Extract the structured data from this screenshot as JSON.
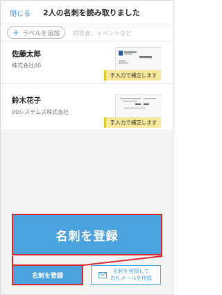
{
  "header": {
    "close_label": "閉じる",
    "title": "2人の名刺を読み取りました"
  },
  "label_bar": {
    "add_label": "ラベルを追加",
    "hint": "同窓会、イベントなど"
  },
  "cards": [
    {
      "name": "佐藤太郎",
      "company": "株式会社00",
      "tag": "手入力で補正します",
      "thumb_name": "佐藤 太郎"
    },
    {
      "name": "鈴木花子",
      "company": "00システムズ株式会社",
      "tag": "手入力で補正します",
      "thumb_name": "鈴木 花子"
    }
  ],
  "zoomed_button_label": "名刺を登録",
  "footer": {
    "register_label": "名刺を登録",
    "register_email_label": "名刺を登録して\nお礼メールを作成"
  },
  "colors": {
    "accent": "#4ca2dd",
    "highlight": "#d62930",
    "tag_bg": "#f6e79a"
  },
  "icons": {
    "add_label": "plus-icon",
    "register_email": "mail-icon"
  }
}
